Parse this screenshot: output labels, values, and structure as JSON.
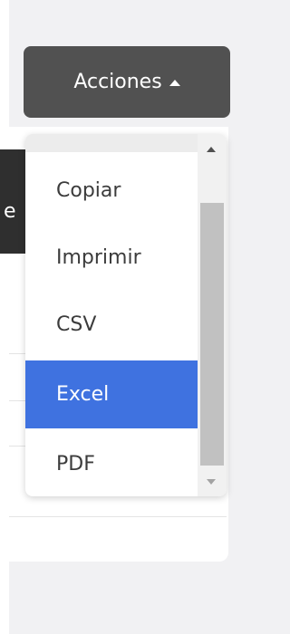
{
  "actions_button": {
    "label": "Acciones"
  },
  "background_text": {
    "partial_label": "e"
  },
  "dropdown": {
    "items": [
      {
        "label": "Copiar",
        "active": false
      },
      {
        "label": "Imprimir",
        "active": false
      },
      {
        "label": "CSV",
        "active": false
      },
      {
        "label": "Excel",
        "active": true
      },
      {
        "label": "PDF",
        "active": false
      }
    ]
  },
  "colors": {
    "button_bg": "#515151",
    "active_item_bg": "#3f72e0",
    "page_bg": "#f1f1f3"
  }
}
